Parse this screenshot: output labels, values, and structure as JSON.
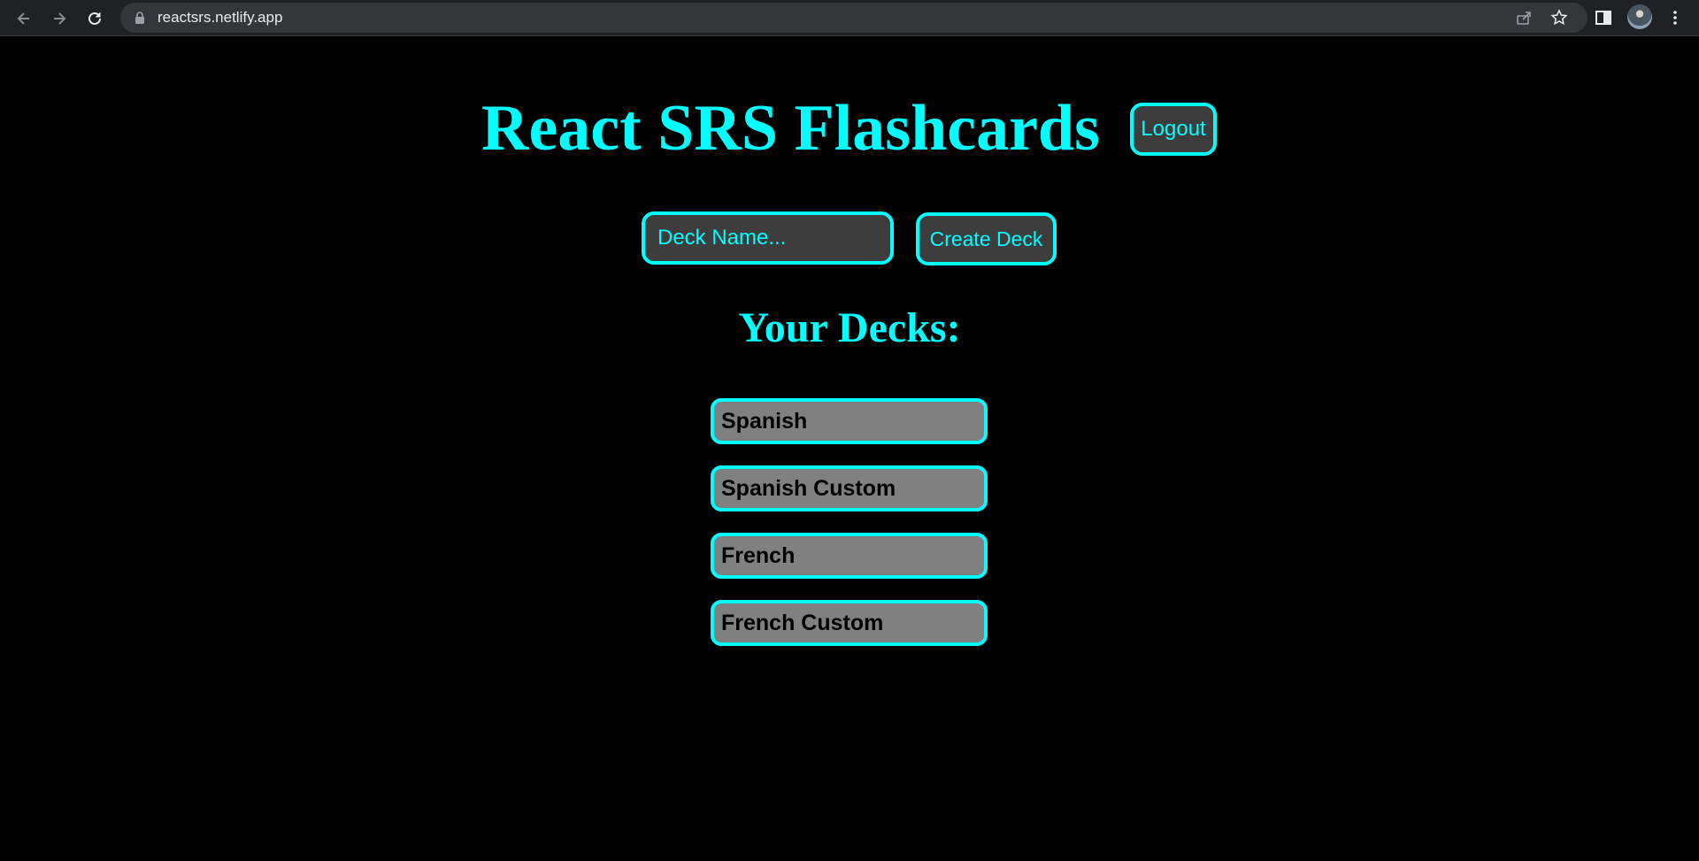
{
  "browser": {
    "url": "reactsrs.netlify.app"
  },
  "header": {
    "title": "React SRS Flashcards",
    "logout_label": "Logout"
  },
  "create_deck": {
    "placeholder": "Deck Name...",
    "value": "",
    "button_label": "Create Deck"
  },
  "decks": {
    "title": "Your Decks:",
    "items": [
      {
        "label": "Spanish"
      },
      {
        "label": "Spanish Custom"
      },
      {
        "label": "French"
      },
      {
        "label": "French Custom"
      }
    ]
  },
  "colors": {
    "accent": "#00ffff",
    "background": "#000000",
    "control_bg": "#3d3d3d",
    "deck_bg": "#808080"
  }
}
